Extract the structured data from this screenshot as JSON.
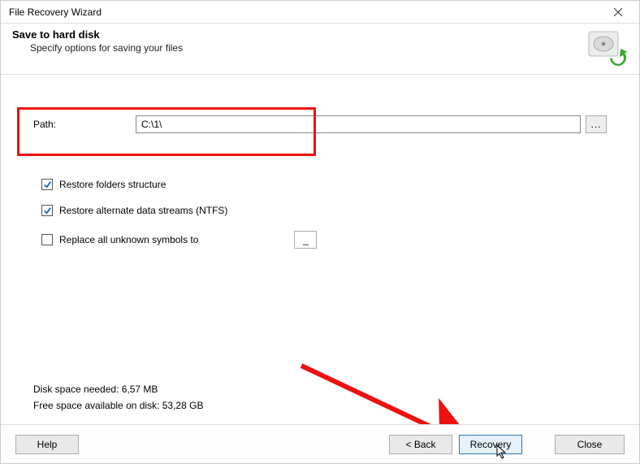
{
  "window": {
    "title": "File Recovery Wizard"
  },
  "header": {
    "title": "Save to hard disk",
    "subtitle": "Specify options for saving your files"
  },
  "path": {
    "label": "Path:",
    "value": "C:\\1\\",
    "browse_label": "..."
  },
  "options": {
    "restore_folders": {
      "label": "Restore folders structure",
      "checked": true
    },
    "restore_streams": {
      "label": "Restore alternate data streams (NTFS)",
      "checked": true
    },
    "replace_unknown": {
      "label": "Replace all unknown symbols to",
      "checked": false,
      "value": "_"
    }
  },
  "disk": {
    "needed": "Disk space needed: 6,57 MB",
    "free": "Free space available on disk: 53,28 GB"
  },
  "buttons": {
    "help": "Help",
    "back": "< Back",
    "recovery": "Recovery",
    "close": "Close"
  }
}
